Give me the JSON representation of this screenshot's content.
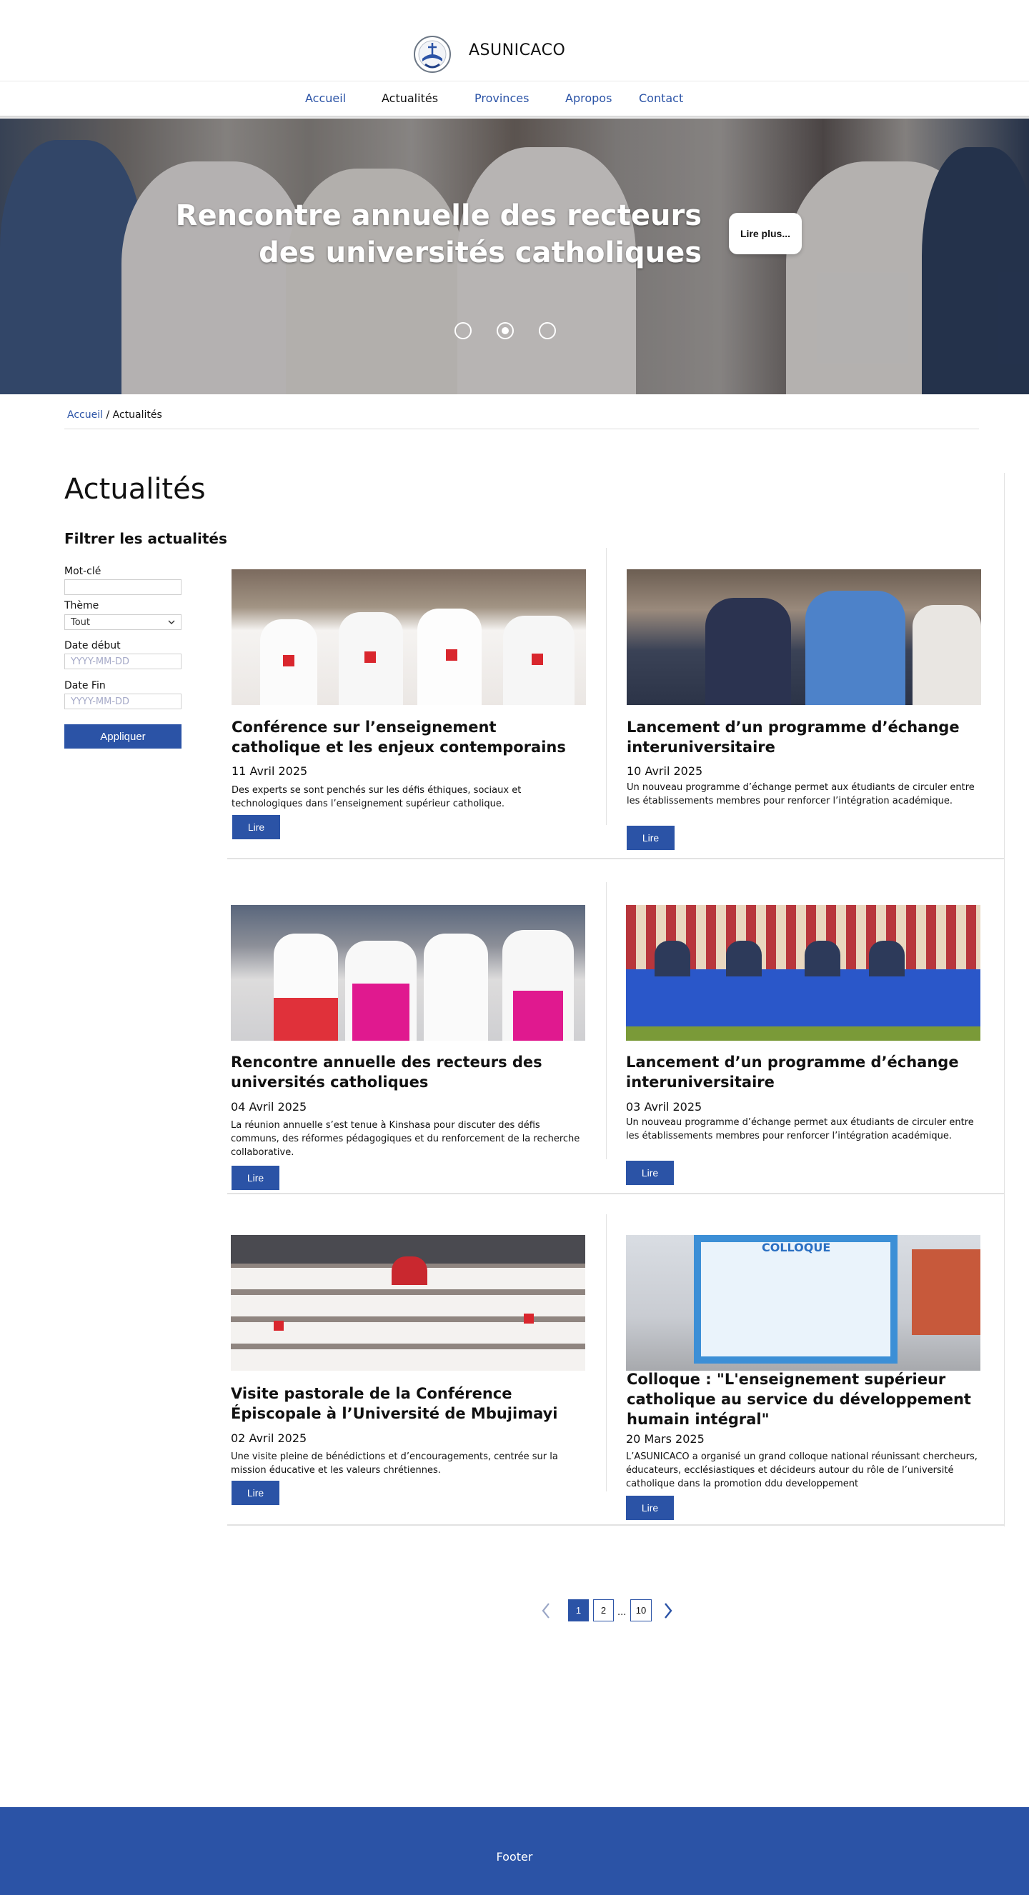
{
  "header": {
    "site_title": "ASUNICACO"
  },
  "nav": {
    "items": [
      {
        "label": "Accueil"
      },
      {
        "label": "Actualités"
      },
      {
        "label": "Provinces"
      },
      {
        "label": "Apropos"
      },
      {
        "label": "Contact"
      }
    ],
    "active": "Actualités"
  },
  "hero": {
    "title": "Rencontre annuelle des recteurs des universités catholiques",
    "button_label": "Lire plus...",
    "slide_count": 3,
    "active_slide": 2
  },
  "breadcrumb": {
    "home": "Accueil",
    "separator": " / ",
    "current": "Actualités"
  },
  "page": {
    "title": "Actualités"
  },
  "filters": {
    "title": "Filtrer les actualités",
    "keyword_label": "Mot-clé",
    "keyword_value": "",
    "theme_label": "Thème",
    "theme_value": "Tout",
    "start_label": "Date début",
    "start_placeholder": "YYYY-MM-DD",
    "end_label": "Date Fin",
    "end_placeholder": "YYYY-MM-DD",
    "apply_label": "Appliquer"
  },
  "articles": [
    {
      "title": "Conférence sur l’enseignement catholique et les enjeux contemporains",
      "date": "11 Avril 2025",
      "description": "Des experts se sont penchés sur les défis éthiques, sociaux et technologiques dans l’enseignement supérieur catholique.",
      "button": "Lire"
    },
    {
      "title": "Lancement d’un programme d’échange interuniversitaire",
      "date": "10 Avril 2025",
      "description": "Un nouveau programme d’échange permet aux étudiants de circuler entre les établissements membres pour renforcer l’intégration académique.",
      "button": "Lire"
    },
    {
      "title": "Rencontre annuelle des recteurs des universités catholiques",
      "date": "04 Avril 2025",
      "description": "La réunion annuelle s’est tenue à Kinshasa pour discuter des défis communs, des réformes pédagogiques et du renforcement de la recherche collaborative.",
      "button": "Lire"
    },
    {
      "title": "Lancement d’un programme d’échange interuniversitaire",
      "date": "03 Avril 2025",
      "description": "Un nouveau programme d’échange permet aux étudiants de circuler entre les établissements membres pour renforcer l’intégration académique.",
      "button": "Lire"
    },
    {
      "title": "Visite pastorale de la Conférence Épiscopale à l’Université de Mbujimayi",
      "date": "02 Avril 2025",
      "description": "Une visite pleine de bénédictions et d’encouragements, centrée sur la mission éducative et les valeurs chrétiennes.",
      "button": "Lire"
    },
    {
      "title": "Colloque : \"L'enseignement supérieur catholique au service du développement humain intégral\"",
      "date": "20 Mars 2025",
      "description": "L’ASUNICACO a organisé un grand colloque national réunissant chercheurs, éducateurs, ecclésiastiques et décideurs autour du rôle de l’université catholique dans la promotion ddu developpement",
      "button": "Lire",
      "image_text": "COLLOQUE"
    }
  ],
  "pagination": {
    "pages": [
      "1",
      "2",
      "10"
    ],
    "ellipsis": "...",
    "current": "1"
  },
  "footer": {
    "text": "Footer"
  },
  "colors": {
    "brand": "#2b53a6",
    "text": "#111111",
    "divider": "#e2e2e2"
  }
}
